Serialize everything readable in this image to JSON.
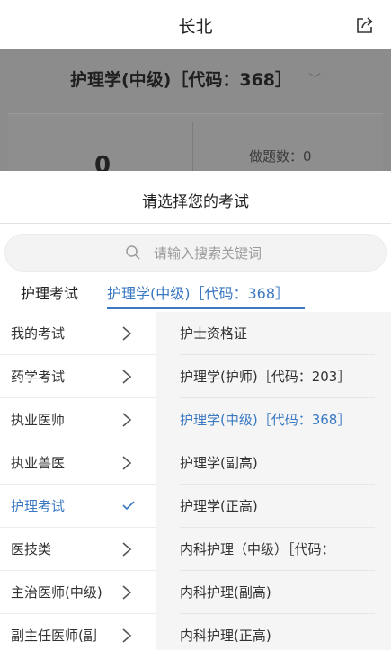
{
  "nav": {
    "title": "长北",
    "share_icon": "share-icon"
  },
  "background_page": {
    "exam_title": "护理学(中级)［代码：368］",
    "exam_caret": "﹀",
    "stat_value": "0",
    "stat_label": "做题数：0"
  },
  "sheet": {
    "title": "请选择您的考试",
    "search": {
      "placeholder": "请输入搜索关键词",
      "value": ""
    },
    "breadcrumb": [
      "护理考试",
      "护理学(中级)［代码：368］"
    ],
    "categories": [
      {
        "label": "我的考试",
        "indicator": "chevron-right-icon"
      },
      {
        "label": "药学考试",
        "indicator": "chevron-right-icon"
      },
      {
        "label": "执业医师",
        "indicator": "chevron-right-icon"
      },
      {
        "label": "执业兽医",
        "indicator": "chevron-right-icon"
      },
      {
        "label": "护理考试",
        "indicator": "check-icon",
        "active": true
      },
      {
        "label": "医技类",
        "indicator": "chevron-right-icon"
      },
      {
        "label": "主治医师(中级)",
        "indicator": "chevron-right-icon"
      },
      {
        "label": "副主任医师(副",
        "indicator": "chevron-right-icon"
      }
    ],
    "options": [
      {
        "label": "护士资格证"
      },
      {
        "label": "护理学(护师)［代码：203］"
      },
      {
        "label": "护理学(中级)［代码：368］",
        "selected": true
      },
      {
        "label": "护理学(副高)"
      },
      {
        "label": "护理学(正高)"
      },
      {
        "label": "内科护理（中级）［代码："
      },
      {
        "label": "内科护理(副高)"
      },
      {
        "label": "内科护理(正高)"
      }
    ]
  },
  "colors": {
    "accent": "#3a78c2",
    "overlay": "#8c8c8c",
    "panel": "#f5f5f5"
  }
}
